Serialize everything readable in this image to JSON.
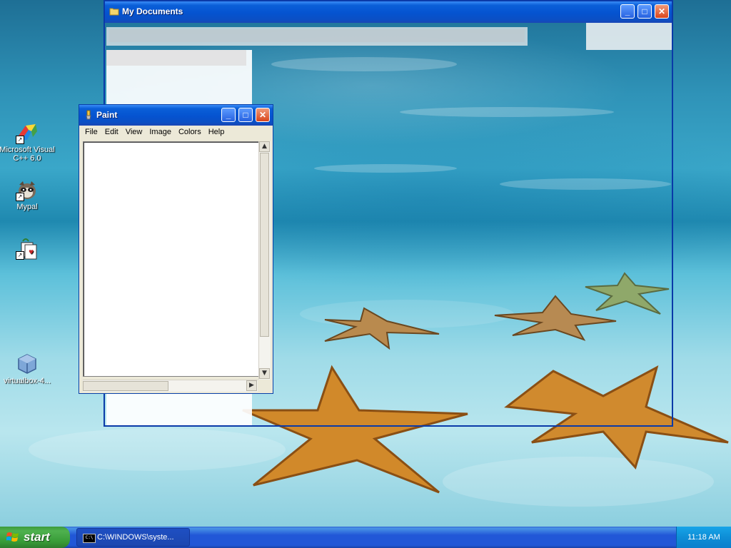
{
  "desktop": {
    "icons": [
      {
        "label": "Microsoft Visual C++ 6.0"
      },
      {
        "label": "Mypal"
      },
      {
        "label": ""
      },
      {
        "label": "virtualbox-4..."
      }
    ]
  },
  "mydocs": {
    "title": "My Documents"
  },
  "paint": {
    "title": "Paint",
    "menu": [
      "File",
      "Edit",
      "View",
      "Image",
      "Colors",
      "Help"
    ]
  },
  "taskbar": {
    "start_label": "start",
    "task_item": "C:\\WINDOWS\\syste...",
    "clock": "11:18 AM"
  },
  "colors": {
    "xp_blue": "#0553d0",
    "start_green": "#389c38",
    "tray_blue": "#0e8ed6"
  }
}
